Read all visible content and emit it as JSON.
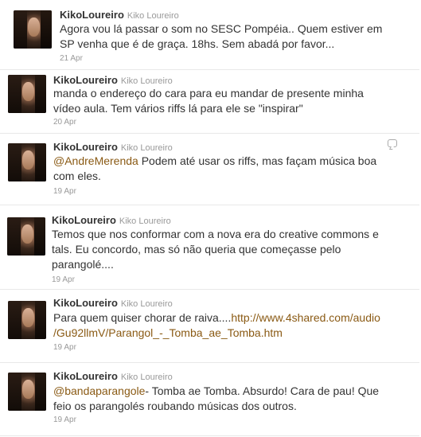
{
  "tweets": [
    {
      "screen_name": "KikoLoureiro",
      "full_name": "Kiko Loureiro",
      "text_lines": [
        "Agora vou lá passar o som no SESC Pompéia.. Quem estiver em",
        "SP venha que é de graça. 18hs. Sem abadá por favor..."
      ],
      "date": "21 Apr",
      "avatar_icon": "profile-photo-icon"
    },
    {
      "screen_name": "KikoLoureiro",
      "full_name": "Kiko Loureiro",
      "text_lines": [
        "manda o endereço do cara para eu mandar de presente minha",
        "vídeo aula. Tem vários riffs lá para ele se \"inspirar\""
      ],
      "date": "20 Apr",
      "avatar_icon": "profile-photo-icon"
    },
    {
      "screen_name": "KikoLoureiro",
      "full_name": "Kiko Loureiro",
      "mention": "@AndreMerenda",
      "text_after_mention": " Podem até usar os riffs, mas façam música boa",
      "text_line2": "com eles.",
      "date": "19 Apr",
      "reply_icon": "reply-bubble-icon",
      "avatar_icon": "profile-photo-icon"
    },
    {
      "screen_name": "KikoLoureiro",
      "full_name": "Kiko Loureiro",
      "text_lines": [
        "Temos que nos conformar com a nova era do creative commons e",
        "tals. Eu concordo, mas só não queria que começasse pelo",
        "parangolé...."
      ],
      "date": "19 Apr",
      "avatar_icon": "profile-photo-icon"
    },
    {
      "screen_name": "KikoLoureiro",
      "full_name": "Kiko Loureiro",
      "text_before_link": "Para quem quiser chorar de raiva....",
      "link_line1": "http://www.4shared.com/audio",
      "link_line2": "/Gu92llmV/Parangol_-_Tomba_ae_Tomba.htm",
      "date": "19 Apr",
      "avatar_icon": "profile-photo-icon"
    },
    {
      "screen_name": "KikoLoureiro",
      "full_name": "Kiko Loureiro",
      "mention": "@bandaparangole",
      "text_after_mention": "- Tomba ae Tomba. Absurdo! Cara de pau! Que",
      "text_line2": "feio os parangolés roubando músicas dos outros.",
      "date": "19 Apr",
      "avatar_icon": "profile-photo-icon"
    }
  ],
  "colors": {
    "link": "#8a5a14",
    "meta": "#999999",
    "text": "#333333"
  }
}
